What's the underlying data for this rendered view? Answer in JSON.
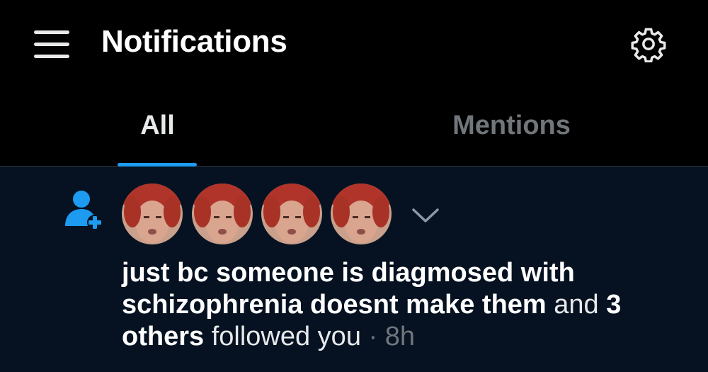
{
  "header": {
    "title": "Notifications",
    "menu_icon": "hamburger-menu-icon",
    "settings_icon": "gear-icon"
  },
  "tabs": [
    {
      "label": "All",
      "active": true
    },
    {
      "label": "Mentions",
      "active": false
    }
  ],
  "notification": {
    "type_icon": "person-add-icon",
    "avatar_count": 4,
    "user_name": "just bc someone is diagmosed with schizophrenia doesnt make them",
    "connector": "and",
    "others": "3 others",
    "action": "followed you",
    "separator": "·",
    "time": "8h"
  },
  "colors": {
    "background": "#000000",
    "notification_bg": "#061221",
    "accent": "#1d9bf0",
    "text_primary": "#e7e9ea",
    "text_secondary": "#71767b"
  }
}
